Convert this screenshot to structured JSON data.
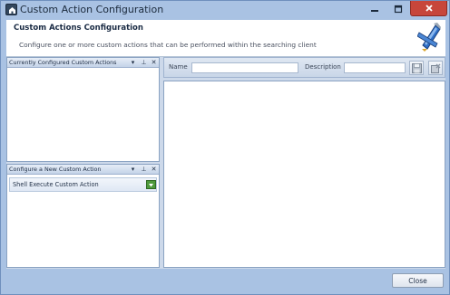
{
  "window": {
    "title": "Custom Action Configuration",
    "controls": {
      "minimize": "minimize-icon",
      "maximize": "maximize-icon",
      "close": "close-icon"
    }
  },
  "header": {
    "title": "Custom Actions Configuration",
    "subtitle": "Configure one or more custom actions that can be performed within the searching client",
    "logo_icon": "custom-actions-logo-icon"
  },
  "current_panel": {
    "title": "Currently Configured Custom Actions",
    "items": []
  },
  "new_panel": {
    "title": "Configure a New Custom Action",
    "items": [
      {
        "label": "Shell Execute Custom Action",
        "action_icon": "add-icon"
      }
    ]
  },
  "panel_tools": {
    "dropdown": "▾",
    "pin": "⊥",
    "close": "✕"
  },
  "toolbar": {
    "name_label": "Name",
    "name_value": "",
    "description_label": "Description",
    "description_value": "",
    "save_icon": "save-icon",
    "delete_icon": "delete-icon"
  },
  "footer": {
    "close_label": "Close"
  },
  "colors": {
    "window_frame": "#a9c2e3",
    "close_button": "#c7463b",
    "add_button": "#4e9a3c",
    "panel_border": "#8aa2c2"
  }
}
